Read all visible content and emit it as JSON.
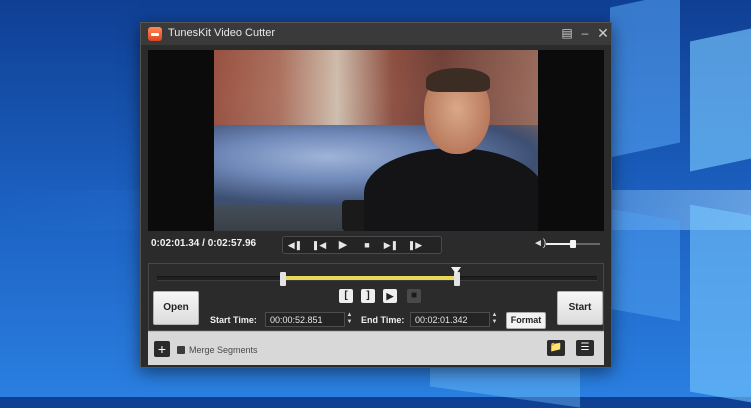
{
  "window": {
    "title": "TunesKit Video Cutter",
    "icons": {
      "logo": "app-logo-icon",
      "register": "register-icon",
      "minimize": "minimize-icon",
      "close": "close-icon"
    }
  },
  "player": {
    "current_time": "0:02:01.34",
    "total_time": "0:02:57.96",
    "time_display": "0:02:01.34 / 0:02:57.96",
    "transport": [
      "previous-frame-icon",
      "step-back-icon",
      "play-icon",
      "stop-icon",
      "step-forward-icon",
      "next-frame-icon"
    ],
    "volume_level": 0.5,
    "playback_position": 0.68
  },
  "editor": {
    "segment_start_fraction": 0.286,
    "segment_end_fraction": 0.682,
    "mark_buttons": [
      "[",
      "]",
      "play-segment-icon",
      "stop-segment-icon"
    ],
    "open_label": "Open",
    "start_time_label": "Start Time:",
    "start_time_value": "00:00:52.851",
    "end_time_label": "End Time:",
    "end_time_value": "00:02:01.342",
    "format_label": "Format",
    "start_label": "Start"
  },
  "footer": {
    "add_icon": "plus-icon",
    "merge_label": "Merge Segments",
    "merge_checked": false,
    "folder_icon": "folder-icon",
    "list_icon": "list-icon"
  },
  "colors": {
    "segment": "#e6d85a",
    "window_bg": "#2b2b2b",
    "desktop": "#1d63c4"
  }
}
